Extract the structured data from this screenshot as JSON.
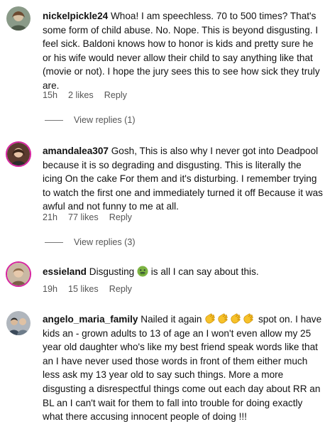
{
  "comments": [
    {
      "username": "nickelpickle24",
      "text": " Whoa! I am speechless. 70 to 500 times? That's some form of child abuse. No. Nope. This is beyond disgusting. I feel sick. Baldoni knows how to honor is kids and pretty sure he or his wife would never allow their child to say anything like that (movie or not). I hope the jury sees this to see how sick they truly are.",
      "time": "15h",
      "likes": "2 likes",
      "reply": "Reply",
      "view_replies": "View replies (1)"
    },
    {
      "username": "amandalea307",
      "text": " Gosh, This is also why I never got into Deadpool because it is so degrading and disgusting. This is literally the icing On the cake For them and it's disturbing. I remember trying to watch the first one and immediately turned it off Because it was awful and not funny to me at all.",
      "time": "21h",
      "likes": "77 likes",
      "reply": "Reply",
      "view_replies": "View replies (3)"
    },
    {
      "username": "essieland",
      "text_before": " Disgusting ",
      "emoji": "nauseated-face-icon",
      "text_after": " is all I can say about this.",
      "time": "19h",
      "likes": "15 likes",
      "reply": "Reply"
    },
    {
      "username": "angelo_maria_family",
      "text_before": " Nailed it again ",
      "emoji": "clapping-hands-icon",
      "text_after": " spot on. I have kids an - grown adults to 13 of age an I won't even allow my 25 year old daughter who's like my best friend speak words like that an I have never used those words in front of them either much less ask my 13 year old to say such things. More a more disgusting a disrespectful things come out each day about RR an BL an I can't wait for them to fall into trouble for doing exactly what there accusing innocent people of doing !!!"
    }
  ],
  "colors": {
    "text": "#111111",
    "meta": "#555555",
    "story_ring": "#d6249f",
    "clap_yellow": "#f7c22b"
  }
}
